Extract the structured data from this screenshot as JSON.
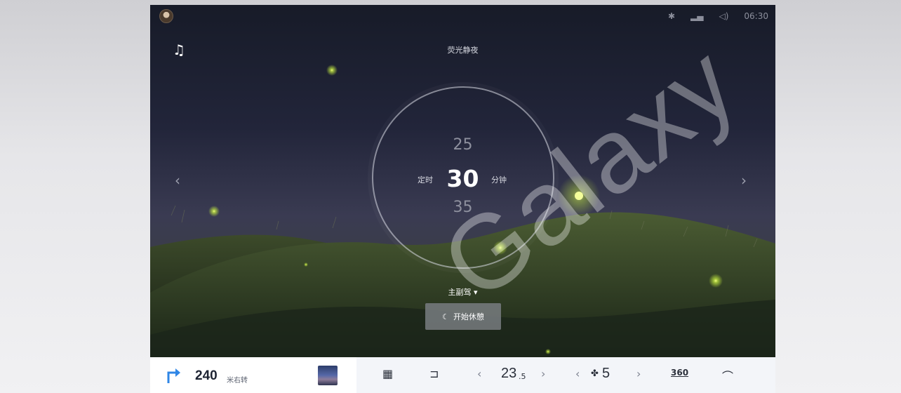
{
  "screen": {
    "scene_title": "荧光静夜",
    "status_bar": {
      "time": "06:30",
      "icons": [
        "avatar",
        "bluetooth-icon",
        "signal-icon",
        "volume-icon"
      ]
    },
    "icons": {
      "music": "music-note-icon",
      "left_arrow": "‹",
      "right_arrow": "›"
    },
    "timer": {
      "above": "25",
      "current": "30",
      "below": "35",
      "prefix_label": "定时",
      "unit_label": "分钟"
    },
    "seat_selector": "主副驾",
    "rest_button_label": "开始休憩",
    "colors": {
      "firefly": "#c8f040",
      "dial_ring": "#dcdee8",
      "button_bg": "#787c80"
    }
  },
  "dock": {
    "navigation": {
      "distance": "240",
      "distance_unit": "米右转",
      "turn_icon": "turn-right-arrow-icon"
    },
    "apps_icon": "apps-grid-icon",
    "seat_icon": "seat-icon",
    "temperature": {
      "value": "23",
      "decimal": ".5",
      "decrease": "‹",
      "increase": "›"
    },
    "fan": {
      "level": "5",
      "decrease": "‹",
      "increase": "›"
    },
    "icon_360_label": "360",
    "wiper_icon": "wiper-icon",
    "accent_color": "#2f86e6"
  },
  "watermark": "Galaxy"
}
